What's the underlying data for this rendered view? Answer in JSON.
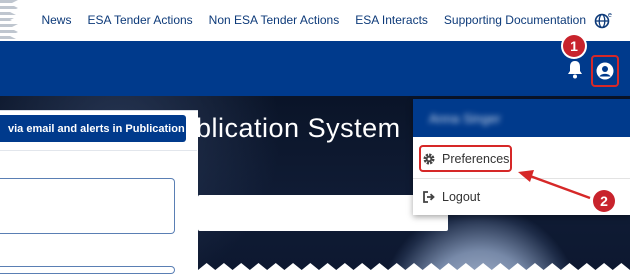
{
  "topnav": {
    "links": [
      "News",
      "ESA Tender Actions",
      "Non ESA Tender Actions",
      "ESA Interacts",
      "Supporting Documentation"
    ],
    "language_icon": "globe-icon",
    "language_superscript": "e"
  },
  "header": {
    "notification_icon": "bell-icon",
    "user_icon": "user-circle-icon"
  },
  "hero": {
    "title": "blication System",
    "search_placeholder": ""
  },
  "left_panel": {
    "email_button_label": "via email and alerts in Publication"
  },
  "user_menu": {
    "user_name": "Anna Singer",
    "items": [
      {
        "label": "Preferences",
        "icon": "gear-icon"
      },
      {
        "label": "Logout",
        "icon": "sign-out-icon"
      }
    ]
  },
  "annotations": {
    "step1": "1",
    "step2": "2",
    "highlight_color": "#d62828"
  },
  "colors": {
    "brand_blue": "#003a8c",
    "nav_text": "#0d3a79"
  }
}
